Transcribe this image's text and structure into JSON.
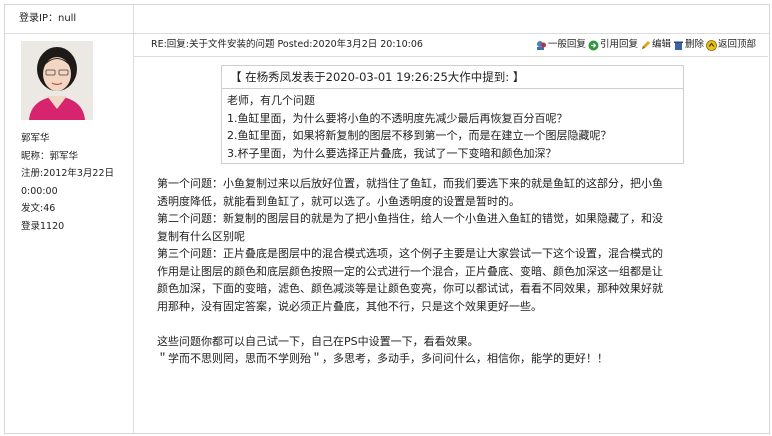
{
  "login_ip": "登录IP：null",
  "user": {
    "name": "郭军华",
    "nickname": "昵称：郭军华",
    "registered": "注册:2012年3月22日",
    "reg_time": "0:00:00",
    "posts": "发文:46",
    "logins": "登录1120"
  },
  "post": {
    "title": "RE:回复:关于文件安装的问题 Posted:2020年3月2日 20:10:06",
    "actions": {
      "reply": "一般回复",
      "quote_reply": "引用回复",
      "edit": "编辑",
      "delete": "删除",
      "top": "返回顶部"
    }
  },
  "quote": {
    "header": "【 在杨秀凤发表于2020-03-01 19:26:25大作中提到: 】",
    "lines": [
      "老师，有几个问题",
      "1.鱼缸里面，为什么要将小鱼的不透明度先减少最后再恢复百分百呢？",
      "2.鱼缸里面，如果将新复制的图层不移到第一个，而是在建立一个图层隐藏呢？",
      "3.杯子里面，为什么要选择正片叠底，我试了一下变暗和颜色加深？"
    ]
  },
  "answer": {
    "p1_l1": "第一个问题：小鱼复制过来以后放好位置，就挡住了鱼缸，而我们要选下来的就是鱼缸的这部分，把小鱼",
    "p1_l2": "透明度降低，就能看到鱼缸了，就可以选了。小鱼透明度的设置是暂时的。",
    "p2_l1": "第二个问题：新复制的图层目的就是为了把小鱼挡住，给人一个小鱼进入鱼缸的错觉，如果隐藏了，和没",
    "p2_l2": "复制有什么区别呢",
    "p3_l1": "第三个问题：正片叠底是图层中的混合模式选项，这个例子主要是让大家尝试一下这个设置，混合模式的",
    "p3_l2": "作用是让图层的颜色和底层颜色按照一定的公式进行一个混合，正片叠底、变暗、颜色加深这一组都是让",
    "p3_l3": "颜色加深，下面的变暗，滤色、颜色减淡等是让颜色变亮，你可以都试试，看看不同效果，那种效果好就",
    "p3_l4": "用那种，没有固定答案，说必须正片叠底，其他不行，只是这个效果更好一些。",
    "p4": "这些问题你都可以自己试一下，自己在PS中设置一下，看看效果。",
    "p5": "＂学而不思则罔，思而不学则殆＂，多思考，多动手，多问问什么，相信你，能学的更好！！"
  }
}
